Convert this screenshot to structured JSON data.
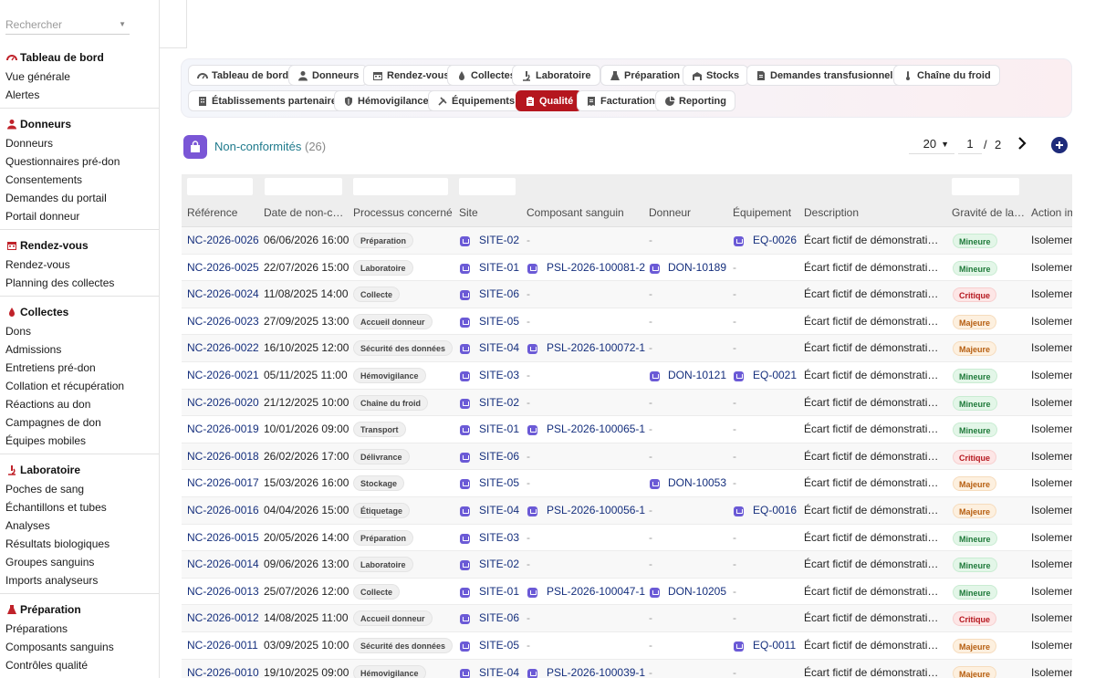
{
  "search": {
    "placeholder": "Rechercher"
  },
  "sidebar": [
    {
      "title": "Tableau de bord",
      "icon": "gauge-icon",
      "items": [
        "Vue générale",
        "Alertes"
      ]
    },
    {
      "title": "Donneurs",
      "icon": "person-icon",
      "items": [
        "Donneurs",
        "Questionnaires pré-don",
        "Consentements",
        "Demandes du portail",
        "Portail donneur"
      ]
    },
    {
      "title": "Rendez-vous",
      "icon": "calendar-icon",
      "items": [
        "Rendez-vous",
        "Planning des collectes"
      ]
    },
    {
      "title": "Collectes",
      "icon": "drop-icon",
      "items": [
        "Dons",
        "Admissions",
        "Entretiens pré-don",
        "Collation et récupération",
        "Réactions au don",
        "Campagnes de don",
        "Équipes mobiles"
      ]
    },
    {
      "title": "Laboratoire",
      "icon": "microscope-icon",
      "items": [
        "Poches de sang",
        "Échantillons et tubes",
        "Analyses",
        "Résultats biologiques",
        "Groupes sanguins",
        "Imports analyseurs"
      ]
    },
    {
      "title": "Préparation",
      "icon": "flask-icon",
      "items": [
        "Préparations",
        "Composants sanguins",
        "Contrôles qualité"
      ]
    }
  ],
  "modules": {
    "active": "Qualité",
    "row1": [
      {
        "label": "Tableau de bord",
        "icon": "gauge-icon"
      },
      {
        "label": "Donneurs",
        "icon": "person-icon"
      },
      {
        "label": "Rendez-vous",
        "icon": "calendar-icon"
      },
      {
        "label": "Collectes",
        "icon": "drop-icon"
      },
      {
        "label": "Laboratoire",
        "icon": "microscope-icon"
      },
      {
        "label": "Préparation",
        "icon": "flask-icon"
      },
      {
        "label": "Stocks",
        "icon": "warehouse-icon"
      },
      {
        "label": "Demandes transfusionnelles",
        "icon": "document-icon"
      },
      {
        "label": "Chaîne du froid",
        "icon": "thermometer-icon"
      }
    ],
    "row2": [
      {
        "label": "Établissements partenaires",
        "icon": "building-icon"
      },
      {
        "label": "Hémovigilance",
        "icon": "shield-icon"
      },
      {
        "label": "Équipements",
        "icon": "tools-icon"
      },
      {
        "label": "Qualité",
        "icon": "clipboard-icon"
      },
      {
        "label": "Facturation",
        "icon": "invoice-icon"
      },
      {
        "label": "Reporting",
        "icon": "chart-pie-icon"
      }
    ]
  },
  "page": {
    "title": "Non-conformités",
    "count": "(26)",
    "per_page": "20",
    "current_page": "1",
    "separator": "/",
    "total_pages": "2"
  },
  "table": {
    "columns": [
      "Référence",
      "Date de non-c…",
      "Processus concerné",
      "Site",
      "Composant sanguin",
      "Donneur",
      "Équipement",
      "Description",
      "Gravité de la…",
      "Action im"
    ],
    "rows": [
      {
        "ref": "NC-2026-0026",
        "date": "06/06/2026 16:00",
        "process": "Préparation",
        "site": "SITE-02",
        "component": "-",
        "donor": "-",
        "equipment": "EQ-0026",
        "description": "Écart fictif de démonstration…",
        "severity": "Mineure",
        "action": "Isolemen"
      },
      {
        "ref": "NC-2026-0025",
        "date": "22/07/2026 15:00",
        "process": "Laboratoire",
        "site": "SITE-01",
        "component": "PSL-2026-100081-2",
        "donor": "DON-10189",
        "equipment": "-",
        "description": "Écart fictif de démonstration…",
        "severity": "Mineure",
        "action": "Isolemen"
      },
      {
        "ref": "NC-2026-0024",
        "date": "11/08/2025 14:00",
        "process": "Collecte",
        "site": "SITE-06",
        "component": "-",
        "donor": "-",
        "equipment": "-",
        "description": "Écart fictif de démonstration…",
        "severity": "Critique",
        "action": "Isolemen"
      },
      {
        "ref": "NC-2026-0023",
        "date": "27/09/2025 13:00",
        "process": "Accueil donneur",
        "site": "SITE-05",
        "component": "-",
        "donor": "-",
        "equipment": "-",
        "description": "Écart fictif de démonstration…",
        "severity": "Majeure",
        "action": "Isolemen"
      },
      {
        "ref": "NC-2026-0022",
        "date": "16/10/2025 12:00",
        "process": "Sécurité des données",
        "site": "SITE-04",
        "component": "PSL-2026-100072-1",
        "donor": "-",
        "equipment": "-",
        "description": "Écart fictif de démonstration…",
        "severity": "Majeure",
        "action": "Isolemen"
      },
      {
        "ref": "NC-2026-0021",
        "date": "05/11/2025 11:00",
        "process": "Hémovigilance",
        "site": "SITE-03",
        "component": "-",
        "donor": "DON-10121",
        "equipment": "EQ-0021",
        "description": "Écart fictif de démonstration…",
        "severity": "Mineure",
        "action": "Isolemen"
      },
      {
        "ref": "NC-2026-0020",
        "date": "21/12/2025 10:00",
        "process": "Chaîne du froid",
        "site": "SITE-02",
        "component": "-",
        "donor": "-",
        "equipment": "-",
        "description": "Écart fictif de démonstration…",
        "severity": "Mineure",
        "action": "Isolemen"
      },
      {
        "ref": "NC-2026-0019",
        "date": "10/01/2026 09:00",
        "process": "Transport",
        "site": "SITE-01",
        "component": "PSL-2026-100065-1",
        "donor": "-",
        "equipment": "-",
        "description": "Écart fictif de démonstration…",
        "severity": "Mineure",
        "action": "Isolemen"
      },
      {
        "ref": "NC-2026-0018",
        "date": "26/02/2026 17:00",
        "process": "Délivrance",
        "site": "SITE-06",
        "component": "-",
        "donor": "-",
        "equipment": "-",
        "description": "Écart fictif de démonstration…",
        "severity": "Critique",
        "action": "Isolemen"
      },
      {
        "ref": "NC-2026-0017",
        "date": "15/03/2026 16:00",
        "process": "Stockage",
        "site": "SITE-05",
        "component": "-",
        "donor": "DON-10053",
        "equipment": "-",
        "description": "Écart fictif de démonstration…",
        "severity": "Majeure",
        "action": "Isolemen"
      },
      {
        "ref": "NC-2026-0016",
        "date": "04/04/2026 15:00",
        "process": "Étiquetage",
        "site": "SITE-04",
        "component": "PSL-2026-100056-1",
        "donor": "-",
        "equipment": "EQ-0016",
        "description": "Écart fictif de démonstration…",
        "severity": "Majeure",
        "action": "Isolemen"
      },
      {
        "ref": "NC-2026-0015",
        "date": "20/05/2026 14:00",
        "process": "Préparation",
        "site": "SITE-03",
        "component": "-",
        "donor": "-",
        "equipment": "-",
        "description": "Écart fictif de démonstration…",
        "severity": "Mineure",
        "action": "Isolemen"
      },
      {
        "ref": "NC-2026-0014",
        "date": "09/06/2026 13:00",
        "process": "Laboratoire",
        "site": "SITE-02",
        "component": "-",
        "donor": "-",
        "equipment": "-",
        "description": "Écart fictif de démonstration…",
        "severity": "Mineure",
        "action": "Isolemen"
      },
      {
        "ref": "NC-2026-0013",
        "date": "25/07/2026 12:00",
        "process": "Collecte",
        "site": "SITE-01",
        "component": "PSL-2026-100047-1",
        "donor": "DON-10205",
        "equipment": "-",
        "description": "Écart fictif de démonstration…",
        "severity": "Mineure",
        "action": "Isolemen"
      },
      {
        "ref": "NC-2026-0012",
        "date": "14/08/2025 11:00",
        "process": "Accueil donneur",
        "site": "SITE-06",
        "component": "-",
        "donor": "-",
        "equipment": "-",
        "description": "Écart fictif de démonstration…",
        "severity": "Critique",
        "action": "Isolemen"
      },
      {
        "ref": "NC-2026-0011",
        "date": "03/09/2025 10:00",
        "process": "Sécurité des données",
        "site": "SITE-05",
        "component": "-",
        "donor": "-",
        "equipment": "EQ-0011",
        "description": "Écart fictif de démonstration…",
        "severity": "Majeure",
        "action": "Isolemen"
      },
      {
        "ref": "NC-2026-0010",
        "date": "19/10/2025 09:00",
        "process": "Hémovigilance",
        "site": "SITE-04",
        "component": "PSL-2026-100039-1",
        "donor": "-",
        "equipment": "-",
        "description": "Écart fictif de démonstration…",
        "severity": "Majeure",
        "action": "Isolemen"
      }
    ]
  },
  "colors": {
    "accent": "#b5161e",
    "link": "#152f7d",
    "title": "#1f7a8c",
    "object_icon": "#6b5ad6"
  }
}
